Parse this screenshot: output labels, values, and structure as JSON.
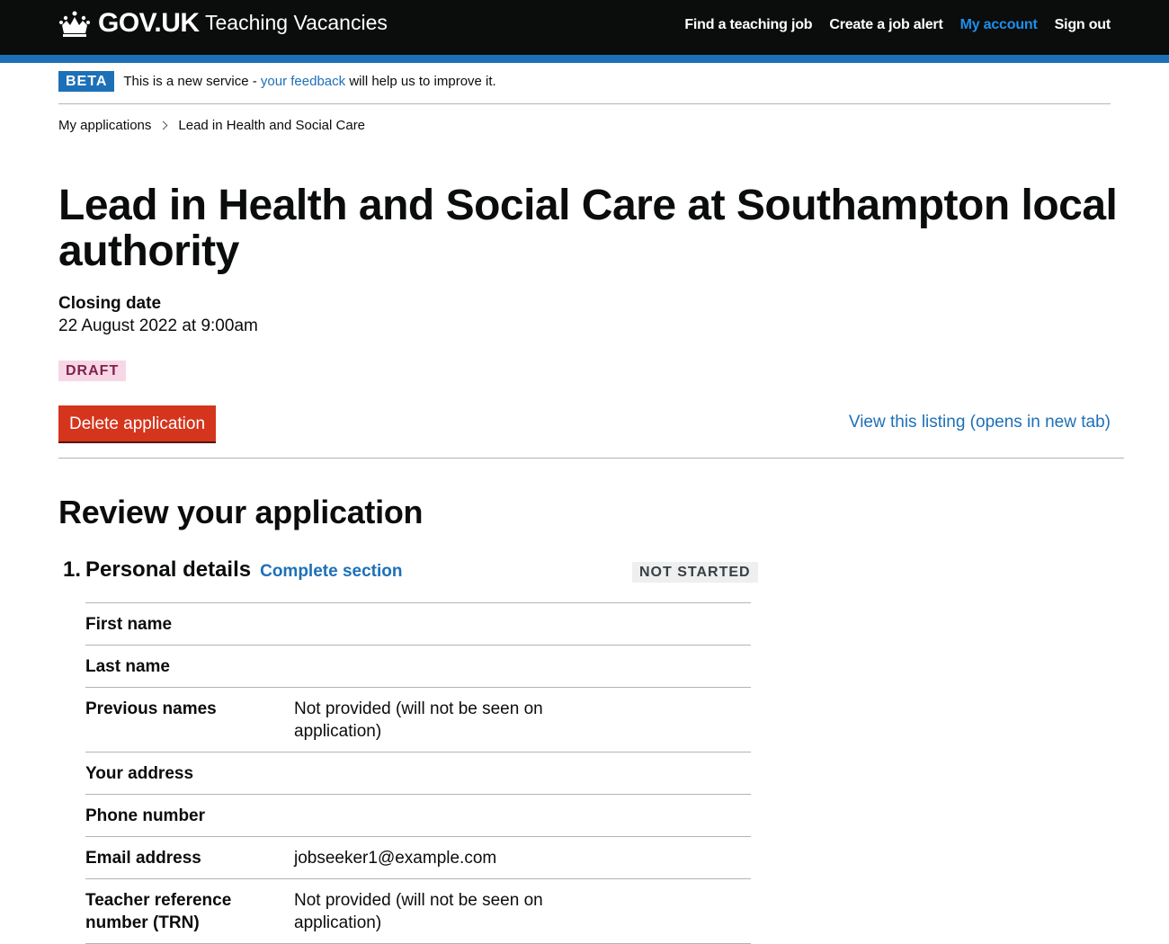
{
  "header": {
    "logo": "GOV.UK",
    "service": "Teaching Vacancies",
    "nav": [
      "Find a teaching job",
      "Create a job alert",
      "My account",
      "Sign out"
    ]
  },
  "beta": {
    "tag": "BETA",
    "text_before": "This is a new service - ",
    "link": "your feedback",
    "text_after": " will help us to improve it."
  },
  "breadcrumb": {
    "parent": "My applications",
    "current": "Lead in Health and Social Care"
  },
  "page": {
    "title": "Lead in Health and Social Care at Southampton local authority",
    "closing_label": "Closing date",
    "closing_value": "22 August 2022 at 9:00am",
    "status_tag": "DRAFT",
    "delete_button": "Delete application",
    "view_listing": "View this listing (opens in new tab)",
    "review_title": "Review your application"
  },
  "section": {
    "number": "1.",
    "name": "Personal details",
    "action": "Complete section",
    "status": "NOT STARTED",
    "rows": [
      {
        "key": "First name",
        "value": ""
      },
      {
        "key": "Last name",
        "value": ""
      },
      {
        "key": "Previous names",
        "value": "Not provided (will not be seen on application)"
      },
      {
        "key": "Your address",
        "value": ""
      },
      {
        "key": "Phone number",
        "value": ""
      },
      {
        "key": "Email address",
        "value": "jobseeker1@example.com"
      },
      {
        "key": "Teacher reference number (TRN)",
        "value": "Not provided (will not be seen on application)"
      }
    ]
  },
  "colors": {
    "header_bg": "#0b0c0c",
    "brand_blue": "#1d70b8",
    "delete_red": "#d4351c",
    "draft_pink": "#f7d7e6"
  }
}
